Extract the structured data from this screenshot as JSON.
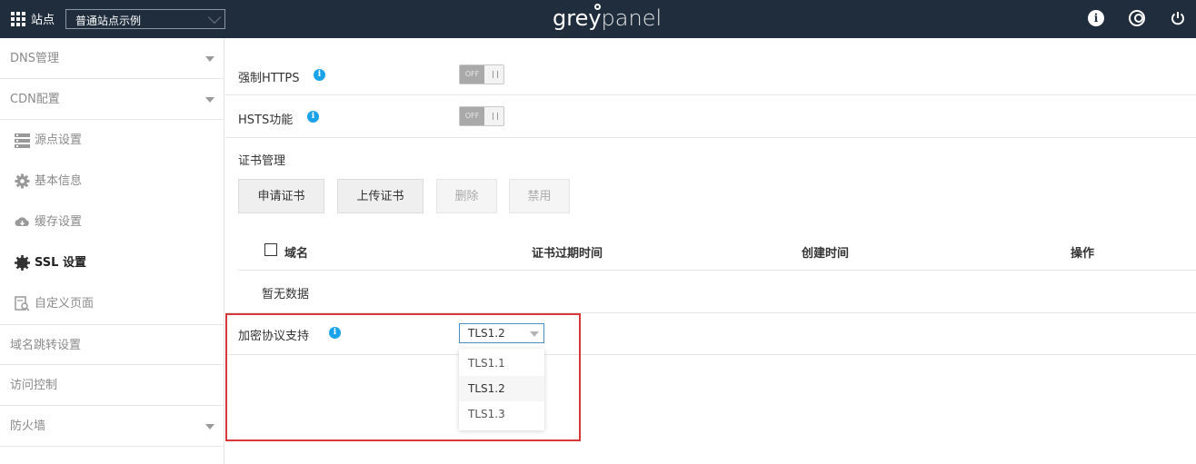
{
  "topbar": {
    "site_label": "站点",
    "site_select_value": "普通站点示例",
    "logo_left": "grey",
    "logo_right": "panel",
    "icons": [
      "info-icon",
      "user-icon",
      "power-icon"
    ],
    "bg_color": "#1f2d3d"
  },
  "sidebar": {
    "items": [
      {
        "label": "DNS管理",
        "caret": true
      },
      {
        "label": "CDN配置",
        "caret": true
      },
      {
        "label": "源点设置",
        "icon": "server-icon"
      },
      {
        "label": "基本信息",
        "icon": "gear-icon"
      },
      {
        "label": "缓存设置",
        "icon": "cloud-icon"
      },
      {
        "label": "SSL 设置",
        "icon": "badge-gear-icon",
        "active": true
      },
      {
        "label": "自定义页面",
        "icon": "page-search-icon"
      },
      {
        "label": "域名跳转设置"
      },
      {
        "label": "访问控制"
      },
      {
        "label": "防火墙",
        "caret": true
      }
    ]
  },
  "main": {
    "force_https": {
      "label": "强制HTTPS",
      "toggle_text": "OFF"
    },
    "hsts": {
      "label": "HSTS功能",
      "toggle_text": "OFF"
    },
    "cert": {
      "title": "证书管理",
      "buttons": {
        "apply": "申请证书",
        "upload": "上传证书",
        "delete": "删除",
        "disable": "禁用"
      },
      "table": {
        "headers": {
          "domain": "域名",
          "expire": "证书过期时间",
          "created": "创建时间",
          "action": "操作"
        },
        "empty_text": "暂无数据"
      }
    },
    "protocol": {
      "label": "加密协议支持",
      "selected": "TLS1.2",
      "options": [
        "TLS1.1",
        "TLS1.2",
        "TLS1.3"
      ]
    },
    "highlight_color": "#d9383a",
    "info_color": "#1aa3e8"
  }
}
